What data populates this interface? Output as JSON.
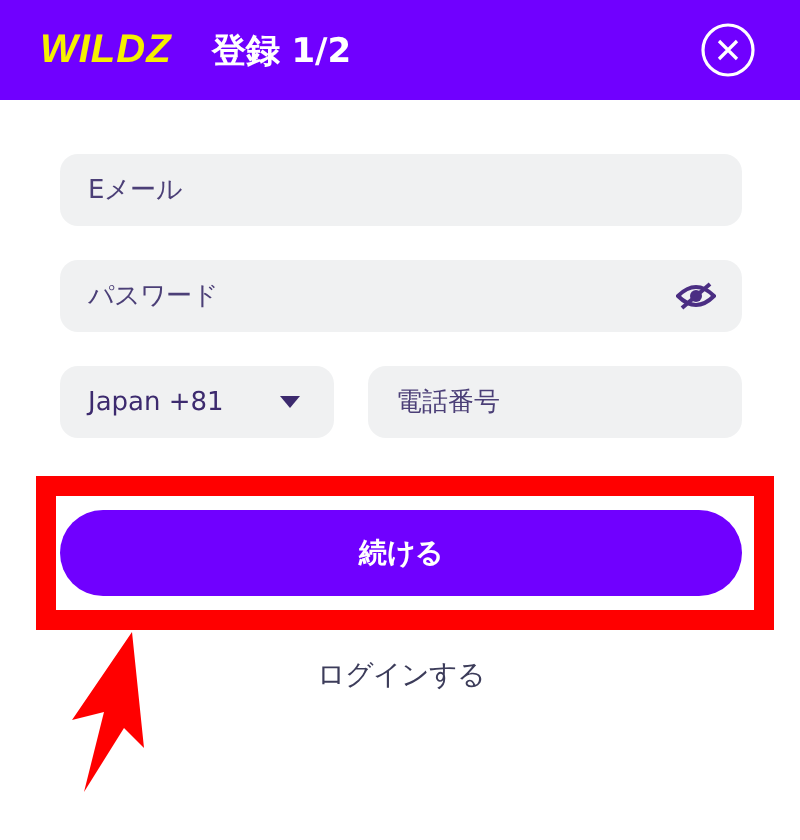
{
  "header": {
    "logo": "WILDZ",
    "title": "登録 1/2"
  },
  "fields": [
    {
      "kind": "text",
      "placeholder": "Eメール"
    },
    {
      "kind": "password",
      "placeholder": "パスワード"
    }
  ],
  "phone": {
    "country": "Japan +81",
    "placeholder": "電話番号"
  },
  "continue_button": "続ける",
  "login_link": "ログインする"
}
